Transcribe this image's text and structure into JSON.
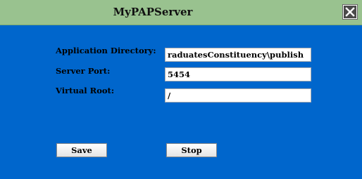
{
  "window": {
    "title": "MyPAPServer",
    "close_icon": "close-icon"
  },
  "form": {
    "app_dir_label": "Application Directory:",
    "app_dir_value": "raduatesConstituency\\publish",
    "port_label": "Server Port:",
    "port_value": "5454",
    "root_label": "Virtual Root:",
    "root_value": "/"
  },
  "buttons": {
    "save": "Save",
    "stop": "Stop"
  },
  "colors": {
    "background": "#0066cc",
    "title_bar": "#99c28f"
  }
}
